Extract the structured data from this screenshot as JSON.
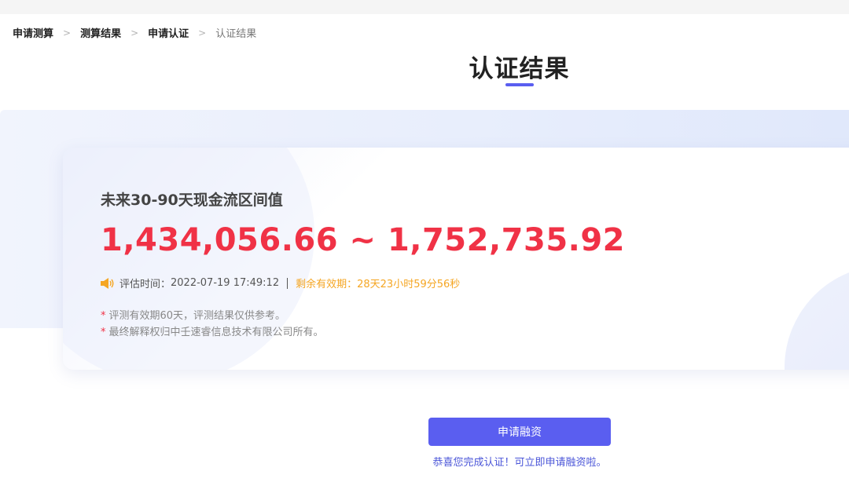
{
  "breadcrumb": {
    "items": [
      "申请测算",
      "测算结果",
      "申请认证",
      "认证结果"
    ]
  },
  "page_title": "认证结果",
  "result": {
    "label": "未来30-90天现金流区间值",
    "range_value": "1,434,056.66 ~ 1,752,735.92",
    "eval_time_label": "评估时间：",
    "eval_time": "2022-07-19 17:49:12",
    "remaining_label": "剩余有效期：",
    "remaining": "28天23小时59分56秒",
    "notes": [
      "评测有效期60天，评测结果仅供参考。",
      "最终解释权归中壬速睿信息技术有限公司所有。"
    ],
    "note_marker": "*"
  },
  "actions": {
    "apply_label": "申请融资",
    "congrats_text": "恭喜您完成认证！可立即申请融资啦。"
  },
  "icons": {
    "breadcrumb_separator": "chevron-right-icon",
    "meta": "speaker-icon"
  },
  "colors": {
    "accent": "#5a5ef0",
    "value_red": "#f03246",
    "remaining_orange": "#f5a623",
    "link_blue": "#4a55d8"
  }
}
